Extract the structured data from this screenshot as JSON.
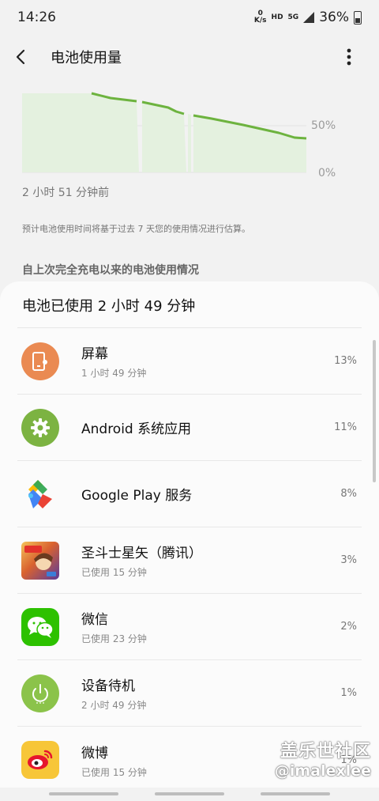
{
  "status_bar": {
    "time": "14:26",
    "net_speed_top": "0",
    "net_speed_bottom": "K/s",
    "hd": "HD",
    "sig": "5G",
    "battery_pct": "36%"
  },
  "app_bar": {
    "title": "电池使用量"
  },
  "chart": {
    "label_50": "50%",
    "label_0": "0%",
    "time_ago": "2 小时 51 分钟前",
    "line_color": "#6db33f",
    "fill_color": "#e4f1df"
  },
  "estimate_note": "预计电池使用时间将基于过去 7 天您的使用情况进行估算。",
  "section_title": "自上次完全充电以来的电池使用情况",
  "card": {
    "header": "电池已使用 2 小时 49 分钟",
    "apps": [
      {
        "name": "屏幕",
        "sub": "1 小时 49 分钟",
        "pct": "13%",
        "icon": "screen-icon",
        "color": "#ea8a52"
      },
      {
        "name": "Android 系统应用",
        "sub": "",
        "pct": "11%",
        "icon": "gear-icon",
        "color": "#7cb342"
      },
      {
        "name": "Google Play 服务",
        "sub": "",
        "pct": "8%",
        "icon": "google-play-services-icon",
        "color": "#ffffff"
      },
      {
        "name": "圣斗士星矢（腾讯）",
        "sub": "已使用 15 分钟",
        "pct": "3%",
        "icon": "saint-seiya-game-icon",
        "color": "#c5472d"
      },
      {
        "name": "微信",
        "sub": "已使用 23 分钟",
        "pct": "2%",
        "icon": "wechat-icon",
        "color": "#2dc100"
      },
      {
        "name": "设备待机",
        "sub": "2 小时 49 分钟",
        "pct": "1%",
        "icon": "power-icon",
        "color": "#8bc34a"
      },
      {
        "name": "微博",
        "sub": "已使用 15 分钟",
        "pct": "1%",
        "icon": "weibo-icon",
        "color": "#f7c638"
      }
    ]
  },
  "watermark": {
    "line1": "盖乐世社区",
    "line2": "@imalexlee"
  }
}
